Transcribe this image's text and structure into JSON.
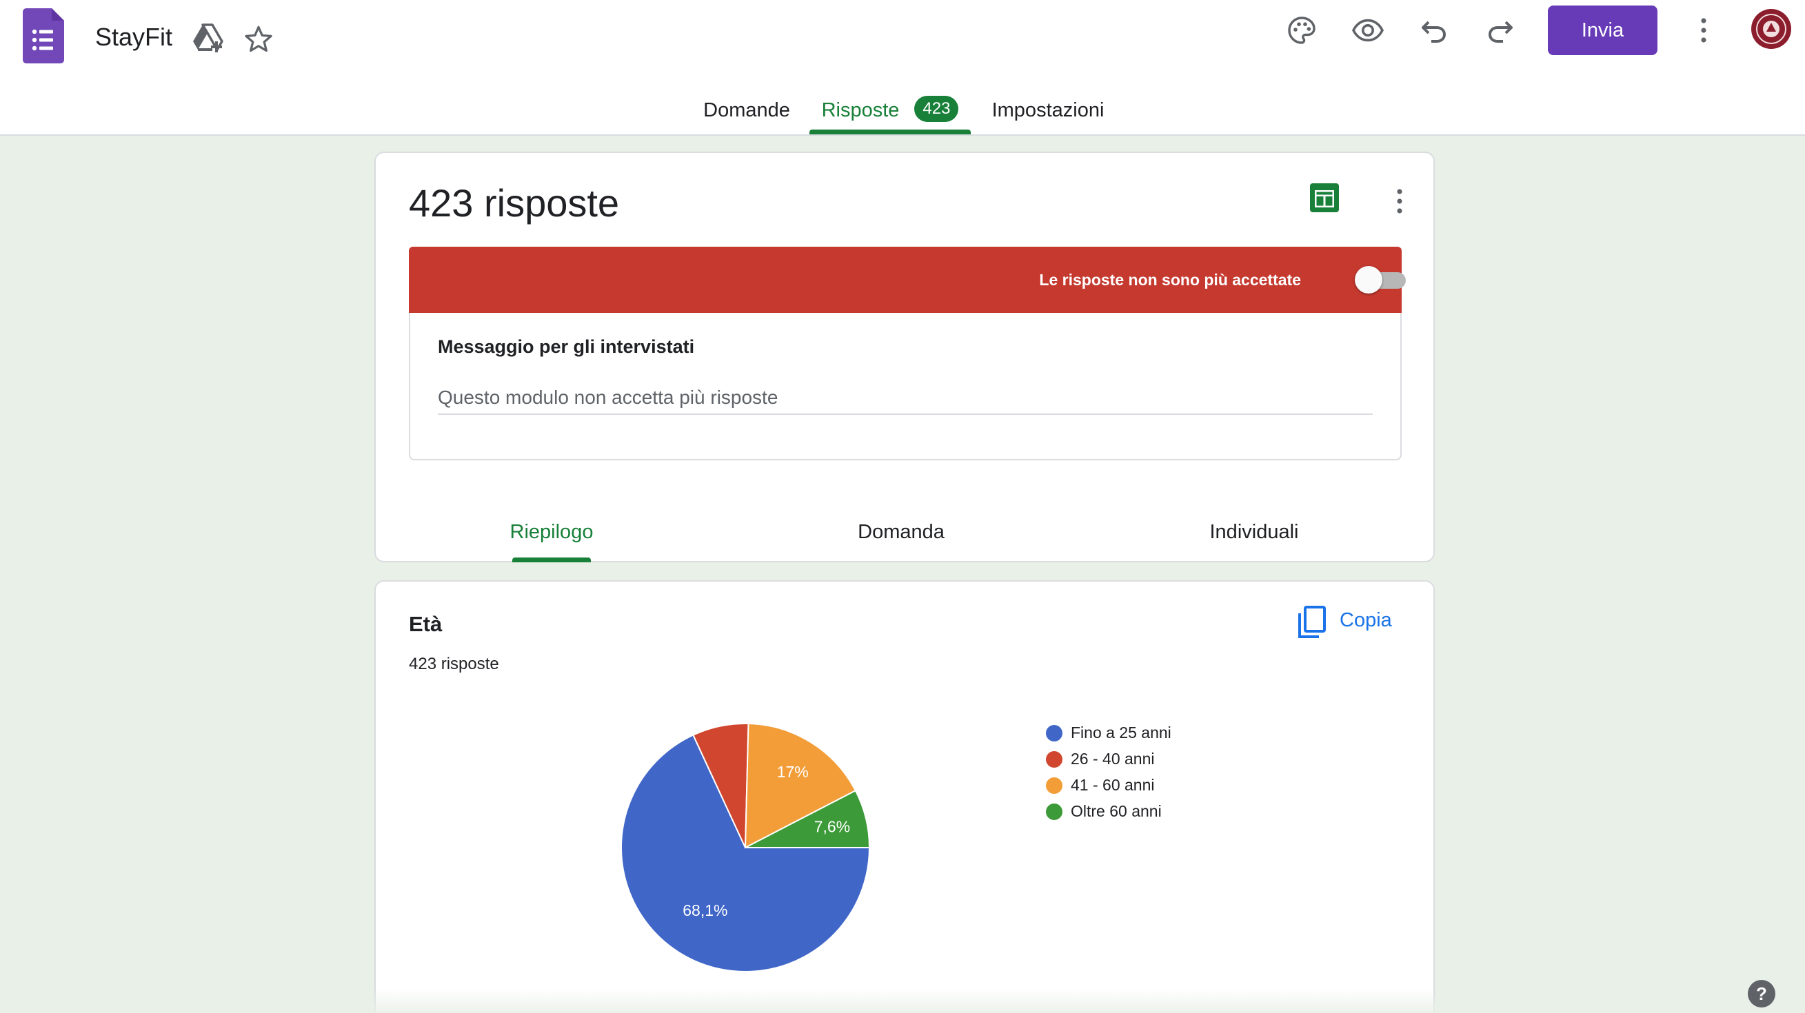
{
  "app": {
    "title": "StayFit",
    "accent_color": "#673ab7",
    "success_color": "#188038"
  },
  "toolbar": {
    "send_label": "Invia",
    "icons": [
      "palette-icon",
      "eye-icon",
      "undo-icon",
      "redo-icon",
      "more-vert-icon"
    ]
  },
  "tabs": {
    "questions": "Domande",
    "responses": "Risposte",
    "responses_badge": "423",
    "settings": "Impostazioni"
  },
  "summary_card": {
    "count_title": "423 risposte",
    "banner_text": "Le risposte non sono più accettate",
    "accepting_responses": false,
    "banner_color": "#c5392f",
    "message_label": "Messaggio per gli intervistati",
    "message_value": "Questo modulo non accetta più risposte",
    "subtabs": [
      "Riepilogo",
      "Domanda",
      "Individuali"
    ]
  },
  "question_card": {
    "title": "Età",
    "count": "423 risposte",
    "copy_label": "Copia"
  },
  "chart_data": {
    "type": "pie",
    "categories": [
      "Fino a 25 anni",
      "26 - 40 anni",
      "41 - 60 anni",
      "Oltre 60 anni"
    ],
    "values": [
      68.1,
      7.3,
      17.0,
      7.6
    ],
    "labels": [
      "68,1%",
      "",
      "17%",
      "7,6%"
    ],
    "colors": [
      "#4066c8",
      "#d1462e",
      "#f29d38",
      "#3d9a38"
    ],
    "legend_position": "right"
  }
}
